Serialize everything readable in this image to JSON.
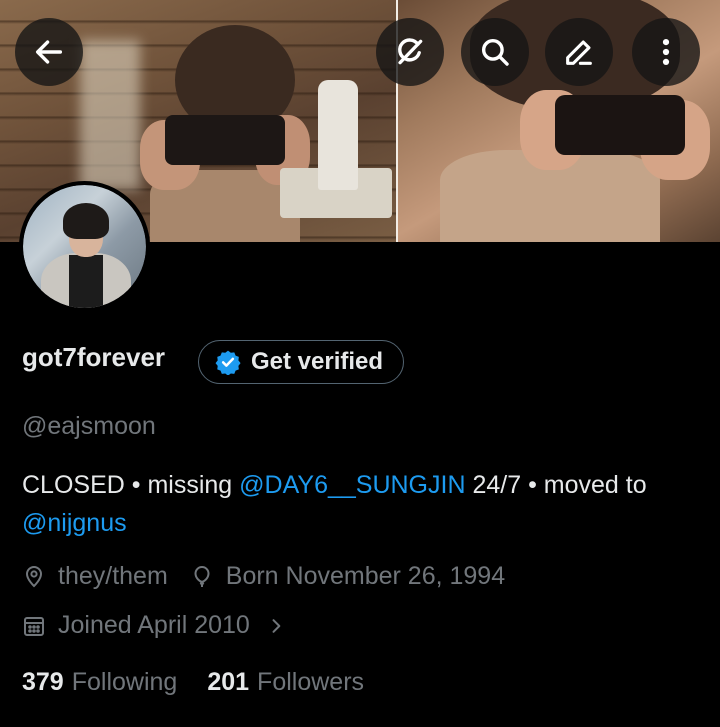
{
  "header": {
    "back_icon": "arrow-left-icon",
    "grok_icon": "grok-icon",
    "search_icon": "search-icon",
    "edit_icon": "edit-pen-icon",
    "more_icon": "more-vertical-icon"
  },
  "profile": {
    "display_name": "got7forever",
    "verify_button_label": "Get verified",
    "handle": "@eajsmoon",
    "bio": {
      "part1": "CLOSED • missing ",
      "mention1": "@DAY6__SUNGJIN",
      "part2": " 24/7 • moved to ",
      "mention2": "@nijgnus"
    },
    "pronouns": "they/them",
    "birthday": "Born November 26, 1994",
    "joined": "Joined April 2010",
    "following_count": "379",
    "following_label": "Following",
    "followers_count": "201",
    "followers_label": "Followers"
  },
  "colors": {
    "background": "#000000",
    "accent": "#1d9bf0",
    "secondary_text": "#71767b",
    "primary_text": "#e7e9ea"
  }
}
